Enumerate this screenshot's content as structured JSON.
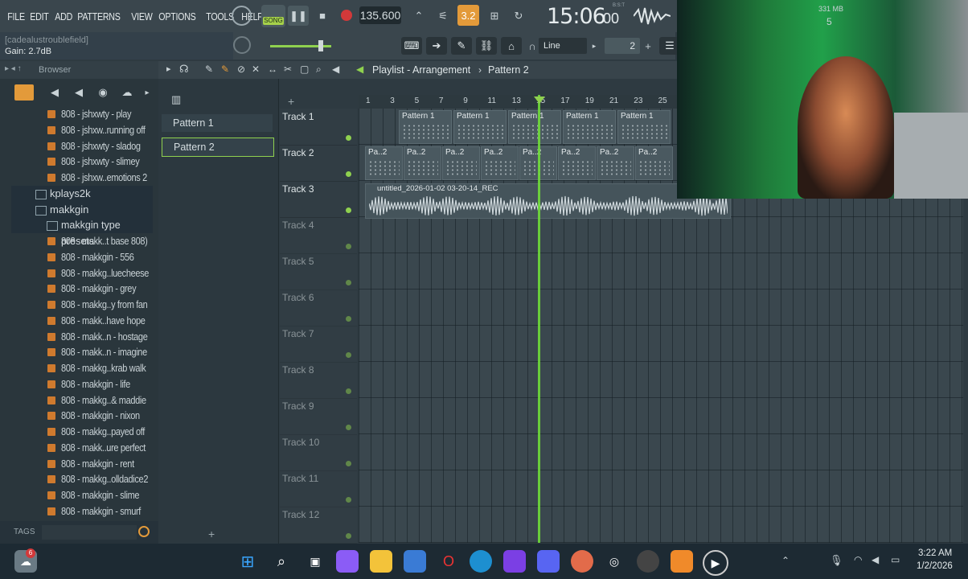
{
  "menu": [
    "FILE",
    "EDIT",
    "ADD",
    "PATTERNS",
    "VIEW",
    "OPTIONS",
    "TOOLS",
    "HELP"
  ],
  "transport": {
    "mode": "SONG",
    "tempo": "135.600",
    "time": "15:06",
    "time_sub": "00",
    "time_unit": "B:S:T"
  },
  "hint": {
    "line1": "[cadealustroublefield]",
    "line2": "Gain:  2.7dB"
  },
  "snap": {
    "value": "Line",
    "step": "2"
  },
  "perf": {
    "mem": "331 MB",
    "cpu": "5"
  },
  "browser": {
    "title": "Browser",
    "items": [
      {
        "type": "file",
        "label": "808 - jshxwty - play"
      },
      {
        "type": "file",
        "label": "808 - jshxw..running off"
      },
      {
        "type": "file",
        "label": "808 - jshxwty - sladog"
      },
      {
        "type": "file",
        "label": "808 - jshxwty - slimey"
      },
      {
        "type": "file",
        "label": "808 - jshxw..emotions 2"
      },
      {
        "type": "folder",
        "label": "kplays2k"
      },
      {
        "type": "folder",
        "label": "makkgin"
      },
      {
        "type": "subfolder",
        "label": "makkgin type presets"
      },
      {
        "type": "file",
        "label": "808 - makk..t base 808)"
      },
      {
        "type": "file",
        "label": "808 - makkgin - 556"
      },
      {
        "type": "file",
        "label": "808 - makkg..luecheese"
      },
      {
        "type": "file",
        "label": "808 - makkgin - grey"
      },
      {
        "type": "file",
        "label": "808 - makkg..y from fan"
      },
      {
        "type": "file",
        "label": "808 - makk..have hope"
      },
      {
        "type": "file",
        "label": "808 - makk..n - hostage"
      },
      {
        "type": "file",
        "label": "808 - makk..n - imagine"
      },
      {
        "type": "file",
        "label": "808 - makkg..krab walk"
      },
      {
        "type": "file",
        "label": "808 - makkgin - life"
      },
      {
        "type": "file",
        "label": "808 - makkg..& maddie"
      },
      {
        "type": "file",
        "label": "808 - makkgin - nixon"
      },
      {
        "type": "file",
        "label": "808 - makkg..payed off"
      },
      {
        "type": "file",
        "label": "808 - makk..ure perfect"
      },
      {
        "type": "file",
        "label": "808 - makkgin - rent"
      },
      {
        "type": "file",
        "label": "808 - makkg..olldadice2"
      },
      {
        "type": "file",
        "label": "808 - makkgin - slime"
      },
      {
        "type": "file",
        "label": "808 - makkgin - smurf"
      }
    ],
    "tags_label": "TAGS"
  },
  "patterns": [
    "Pattern 1",
    "Pattern 2"
  ],
  "playlist": {
    "breadcrumb": [
      "Playlist - Arrangement",
      "Pattern 2"
    ],
    "ruler": [
      "1",
      "3",
      "5",
      "7",
      "9",
      "11",
      "13",
      "15",
      "17",
      "19",
      "21",
      "23",
      "25"
    ],
    "tracks": [
      "Track 1",
      "Track 2",
      "Track 3",
      "Track 4",
      "Track 5",
      "Track 6",
      "Track 7",
      "Track 8",
      "Track 9",
      "Track 10",
      "Track 11",
      "Track 12"
    ],
    "clips_track1": [
      "Pattern 1",
      "Pattern 1",
      "Pattern 1",
      "Pattern 1",
      "Pattern 1"
    ],
    "clips_track2": [
      "Pa..2",
      "Pa..2",
      "Pa..2",
      "Pa..2",
      "Pa..2",
      "Pa..2",
      "Pa..2",
      "Pa..2"
    ],
    "audio_clip": "untitled_2026-01-02 03-20-14_REC"
  },
  "taskbar": {
    "time": "3:22 AM",
    "date": "1/2/2026",
    "badge": "6"
  },
  "colors": {
    "accent": "#6fdc3a",
    "clip": "#4a5960",
    "folder_icon": "#cf7a2e"
  }
}
